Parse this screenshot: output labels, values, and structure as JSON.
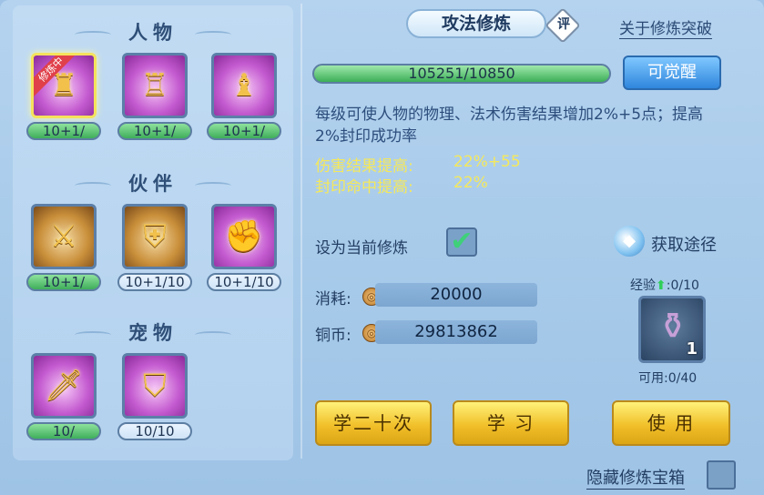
{
  "left": {
    "sections": [
      {
        "title": "人物"
      },
      {
        "title": "伙伴"
      },
      {
        "title": "宠物"
      }
    ],
    "slots": [
      {
        "level": "10+1/",
        "max_hidden": "11",
        "icon": "armor-icon",
        "badge": "修炼中"
      },
      {
        "level": "10+1/",
        "max_hidden": "11",
        "icon": "shield-chest-icon"
      },
      {
        "level": "10+1/",
        "max_hidden": "11",
        "icon": "warrior-statue-icon"
      },
      {
        "level": "10+1/",
        "max_hidden": "11",
        "icon": "lion-sword-icon"
      },
      {
        "level": "10+1/10",
        "icon": "lion-shield-icon"
      },
      {
        "level": "10+1/10",
        "icon": "lion-gauntlet-icon"
      },
      {
        "level": "10/",
        "max_hidden": "11",
        "icon": "cat-sword-icon"
      },
      {
        "level": "10/10",
        "icon": "cat-shield-icon"
      }
    ]
  },
  "right": {
    "title": "攻法修炼",
    "eval_badge": "评",
    "about_link": "关于修炼突破",
    "exp_bar": "105251/10850",
    "exp_fill_fraction": 1.0,
    "awaken_button": "可觉醒",
    "description": "每级可使人物的物理、法术伤害结果增加2%+5点；提高2%封印成功率",
    "stats": [
      {
        "label": "伤害结果提高:",
        "value": "22%+55"
      },
      {
        "label": "封印命中提高:",
        "value": "22%"
      }
    ],
    "set_current_label": "设为当前修炼",
    "set_current_checked": true,
    "get_source_link": "获取途径",
    "cost_label": "消耗:",
    "cost_value": "20000",
    "copper_label": "铜币:",
    "copper_value": "29813862",
    "exp_label": "经验",
    "exp_value": ":0/10",
    "item_count": "1",
    "available": "可用:0/40",
    "buttons": {
      "learn20": "学二十次",
      "learn": "学 习",
      "use": "使 用"
    },
    "hide_label": "隐藏修炼宝箱"
  },
  "colors": {
    "accent_yellow": "#f5e85b",
    "bar_green": "#3cae58",
    "button_gold": "#f1c02a",
    "button_blue": "#2f86dd"
  }
}
